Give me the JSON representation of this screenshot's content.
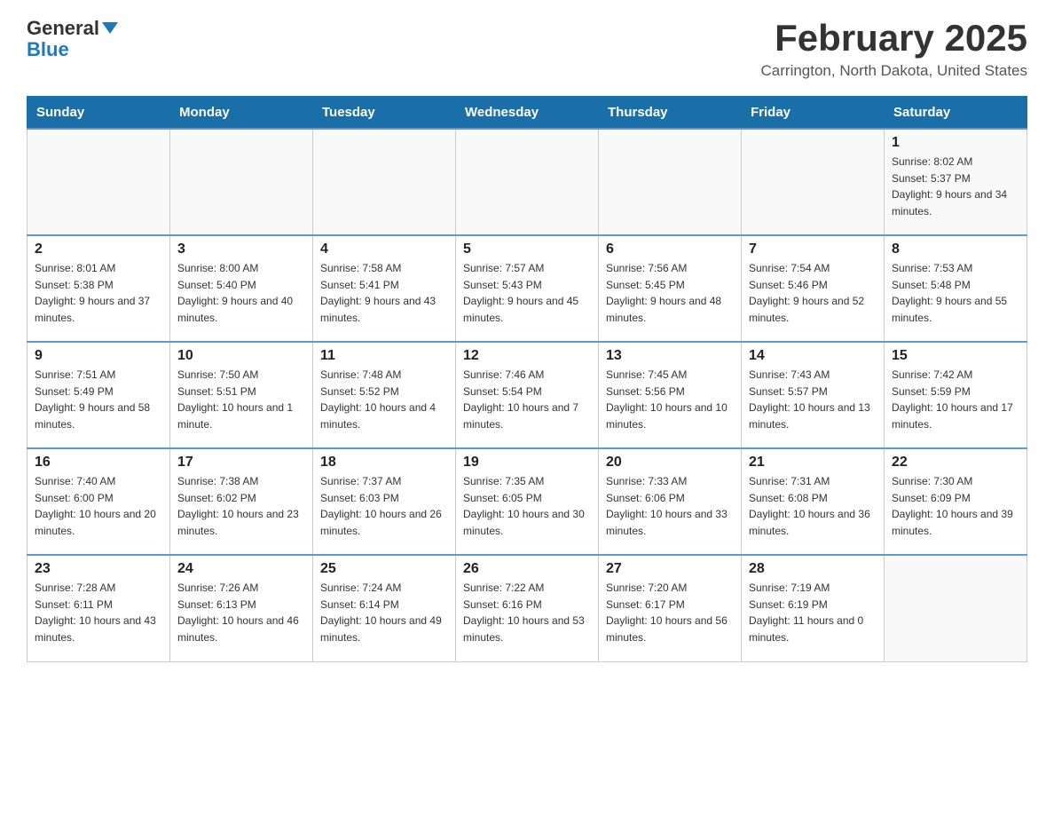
{
  "logo": {
    "general": "General",
    "blue": "Blue"
  },
  "title": "February 2025",
  "subtitle": "Carrington, North Dakota, United States",
  "days_of_week": [
    "Sunday",
    "Monday",
    "Tuesday",
    "Wednesday",
    "Thursday",
    "Friday",
    "Saturday"
  ],
  "weeks": [
    [
      {
        "day": "",
        "info": ""
      },
      {
        "day": "",
        "info": ""
      },
      {
        "day": "",
        "info": ""
      },
      {
        "day": "",
        "info": ""
      },
      {
        "day": "",
        "info": ""
      },
      {
        "day": "",
        "info": ""
      },
      {
        "day": "1",
        "info": "Sunrise: 8:02 AM\nSunset: 5:37 PM\nDaylight: 9 hours and 34 minutes."
      }
    ],
    [
      {
        "day": "2",
        "info": "Sunrise: 8:01 AM\nSunset: 5:38 PM\nDaylight: 9 hours and 37 minutes."
      },
      {
        "day": "3",
        "info": "Sunrise: 8:00 AM\nSunset: 5:40 PM\nDaylight: 9 hours and 40 minutes."
      },
      {
        "day": "4",
        "info": "Sunrise: 7:58 AM\nSunset: 5:41 PM\nDaylight: 9 hours and 43 minutes."
      },
      {
        "day": "5",
        "info": "Sunrise: 7:57 AM\nSunset: 5:43 PM\nDaylight: 9 hours and 45 minutes."
      },
      {
        "day": "6",
        "info": "Sunrise: 7:56 AM\nSunset: 5:45 PM\nDaylight: 9 hours and 48 minutes."
      },
      {
        "day": "7",
        "info": "Sunrise: 7:54 AM\nSunset: 5:46 PM\nDaylight: 9 hours and 52 minutes."
      },
      {
        "day": "8",
        "info": "Sunrise: 7:53 AM\nSunset: 5:48 PM\nDaylight: 9 hours and 55 minutes."
      }
    ],
    [
      {
        "day": "9",
        "info": "Sunrise: 7:51 AM\nSunset: 5:49 PM\nDaylight: 9 hours and 58 minutes."
      },
      {
        "day": "10",
        "info": "Sunrise: 7:50 AM\nSunset: 5:51 PM\nDaylight: 10 hours and 1 minute."
      },
      {
        "day": "11",
        "info": "Sunrise: 7:48 AM\nSunset: 5:52 PM\nDaylight: 10 hours and 4 minutes."
      },
      {
        "day": "12",
        "info": "Sunrise: 7:46 AM\nSunset: 5:54 PM\nDaylight: 10 hours and 7 minutes."
      },
      {
        "day": "13",
        "info": "Sunrise: 7:45 AM\nSunset: 5:56 PM\nDaylight: 10 hours and 10 minutes."
      },
      {
        "day": "14",
        "info": "Sunrise: 7:43 AM\nSunset: 5:57 PM\nDaylight: 10 hours and 13 minutes."
      },
      {
        "day": "15",
        "info": "Sunrise: 7:42 AM\nSunset: 5:59 PM\nDaylight: 10 hours and 17 minutes."
      }
    ],
    [
      {
        "day": "16",
        "info": "Sunrise: 7:40 AM\nSunset: 6:00 PM\nDaylight: 10 hours and 20 minutes."
      },
      {
        "day": "17",
        "info": "Sunrise: 7:38 AM\nSunset: 6:02 PM\nDaylight: 10 hours and 23 minutes."
      },
      {
        "day": "18",
        "info": "Sunrise: 7:37 AM\nSunset: 6:03 PM\nDaylight: 10 hours and 26 minutes."
      },
      {
        "day": "19",
        "info": "Sunrise: 7:35 AM\nSunset: 6:05 PM\nDaylight: 10 hours and 30 minutes."
      },
      {
        "day": "20",
        "info": "Sunrise: 7:33 AM\nSunset: 6:06 PM\nDaylight: 10 hours and 33 minutes."
      },
      {
        "day": "21",
        "info": "Sunrise: 7:31 AM\nSunset: 6:08 PM\nDaylight: 10 hours and 36 minutes."
      },
      {
        "day": "22",
        "info": "Sunrise: 7:30 AM\nSunset: 6:09 PM\nDaylight: 10 hours and 39 minutes."
      }
    ],
    [
      {
        "day": "23",
        "info": "Sunrise: 7:28 AM\nSunset: 6:11 PM\nDaylight: 10 hours and 43 minutes."
      },
      {
        "day": "24",
        "info": "Sunrise: 7:26 AM\nSunset: 6:13 PM\nDaylight: 10 hours and 46 minutes."
      },
      {
        "day": "25",
        "info": "Sunrise: 7:24 AM\nSunset: 6:14 PM\nDaylight: 10 hours and 49 minutes."
      },
      {
        "day": "26",
        "info": "Sunrise: 7:22 AM\nSunset: 6:16 PM\nDaylight: 10 hours and 53 minutes."
      },
      {
        "day": "27",
        "info": "Sunrise: 7:20 AM\nSunset: 6:17 PM\nDaylight: 10 hours and 56 minutes."
      },
      {
        "day": "28",
        "info": "Sunrise: 7:19 AM\nSunset: 6:19 PM\nDaylight: 11 hours and 0 minutes."
      },
      {
        "day": "",
        "info": ""
      }
    ]
  ]
}
